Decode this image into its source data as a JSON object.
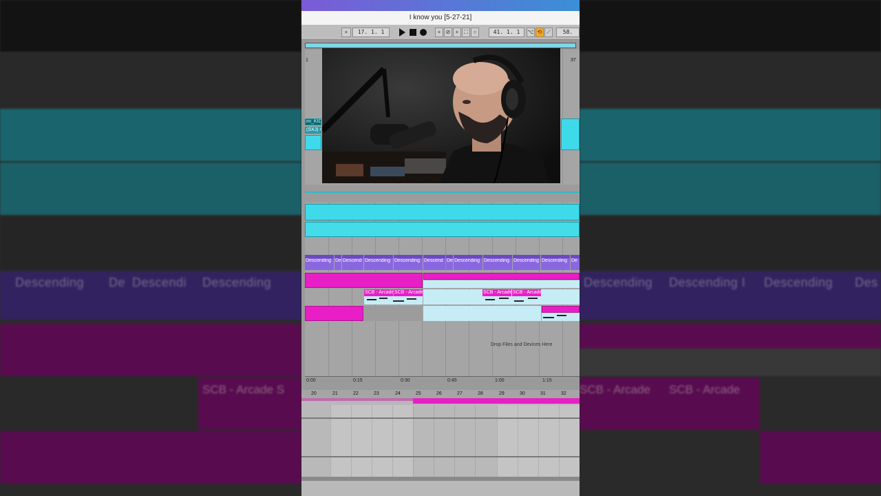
{
  "window": {
    "title": "I know you  [5-27-21]"
  },
  "transport": {
    "position": "17.  1.  1",
    "loop_start": "41.  1.  1",
    "tempo": "58."
  },
  "arrangement": {
    "left_bar": "1",
    "right_bar": "37",
    "track_labels": [
      "ini_KIC",
      "(SXJ) C"
    ],
    "purple_clips": [
      "Descending",
      "De",
      "Descend",
      "Descending",
      "Descending",
      "Descend",
      "De",
      "Descending",
      "Descending",
      "Descending",
      "Descending",
      "De"
    ],
    "pink_clips": [
      "SCB - Arcade",
      "SCB - Arcade",
      "SCB - Arcade",
      "SCB - Arcade"
    ],
    "drop_text": "Drop Files and Devices Here",
    "time_ruler": [
      "0:00",
      "0:15",
      "0:30",
      "0:45",
      "1:00",
      "1:15"
    ]
  },
  "detail_view": {
    "bar_numbers": [
      "20",
      "21",
      "22",
      "23",
      "24",
      "25",
      "26",
      "27",
      "28",
      "29",
      "30",
      "31",
      "32"
    ]
  },
  "background": {
    "left_labels": [
      "Descending",
      "De",
      "Descendi",
      "Descending"
    ],
    "left_pink_label": "SCB - Arcade S",
    "right_labels": [
      "Descending",
      "Descending I",
      "Descending",
      "Des"
    ],
    "right_pink_labels": [
      "SCB - Arcade",
      "SCB - Arcade"
    ]
  },
  "colors": {
    "cyan": "#3fdaea",
    "purple": "#8a66e0",
    "pink": "#e81fc7",
    "light_blue": "#c6ecf6",
    "loop_active": "#f5a623"
  }
}
